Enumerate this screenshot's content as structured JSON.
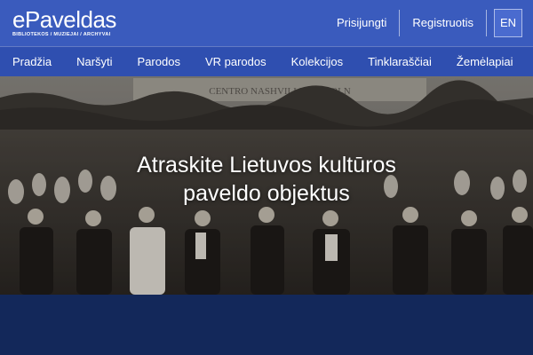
{
  "brand": {
    "name": "ePaveldas",
    "tagline": "BIBLIOTEKOS / MUZIEJAI / ARCHYVAI"
  },
  "header": {
    "login_label": "Prisijungti",
    "register_label": "Registruotis",
    "language_label": "EN"
  },
  "nav": {
    "items": [
      {
        "label": "Pradžia"
      },
      {
        "label": "Naršyti"
      },
      {
        "label": "Parodos"
      },
      {
        "label": "VR parodos"
      },
      {
        "label": "Kolekcijos"
      },
      {
        "label": "Tinklaraščiai"
      },
      {
        "label": "Žemėlapiai"
      }
    ]
  },
  "hero": {
    "title_line1": "Atraskite Lietuvos kultūros",
    "title_line2": "paveldo objektus",
    "banner_text": "CENTRO NASHVILLE LINCOLN"
  },
  "colors": {
    "topbar": "#3a5bbd",
    "navbar": "#2f4fb0",
    "footer": "#13285a"
  }
}
